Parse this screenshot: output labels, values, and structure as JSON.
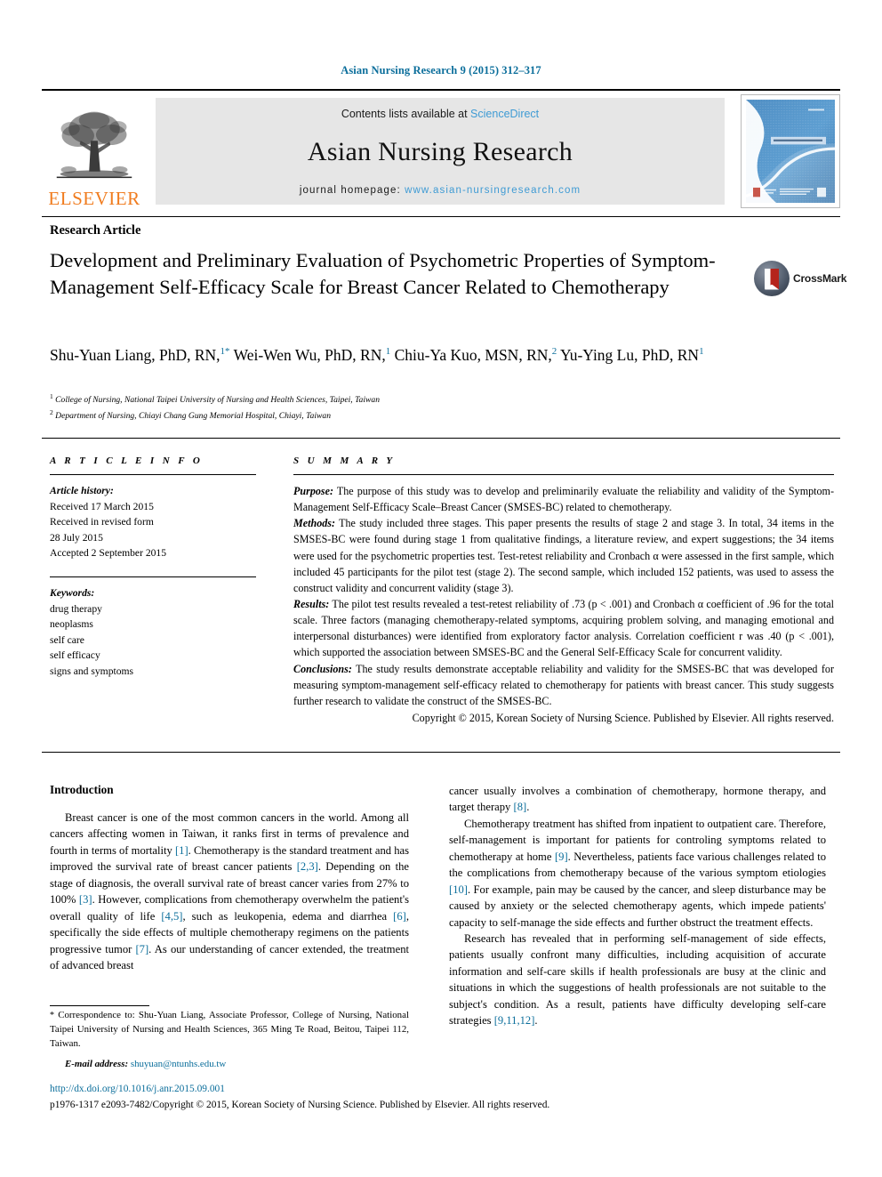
{
  "running_head": "Asian Nursing Research 9 (2015) 312–317",
  "masthead": {
    "contents_prefix": "Contents lists available at ",
    "contents_link": "ScienceDirect",
    "journal_name": "Asian Nursing Research",
    "homepage_prefix": "journal homepage: ",
    "homepage_url": "www.asian-nursingresearch.com",
    "publisher_wordmark": "ELSEVIER",
    "publisher_logo_icon": "elsevier-tree-icon",
    "cover_thumbnail_icon": "journal-cover-thumbnail",
    "cover_title_text": "ASIAN NURSING RESEARCH",
    "link_color": "#3f9bd4",
    "brand_orange": "#f07c1f"
  },
  "article": {
    "kicker": "Research Article",
    "title": "Development and Preliminary Evaluation of Psychometric Properties of Symptom-Management Self-Efficacy Scale for Breast Cancer Related to Chemotherapy",
    "crossmark_label": "CrossMark",
    "crossmark_icon": "crossmark-badge-icon",
    "authors_line1": "Shu-Yuan Liang, PhD, RN,",
    "authors": [
      {
        "name": "Shu-Yuan Liang, PhD, RN,",
        "sup": "1",
        "star": "*"
      },
      {
        "name": "Wei-Wen Wu, PhD, RN,",
        "sup": "1",
        "star": ""
      },
      {
        "name": "Chiu-Ya Kuo, MSN, RN,",
        "sup": "2",
        "star": ""
      },
      {
        "name": "Yu-Ying Lu, PhD, RN",
        "sup": "1",
        "star": ""
      }
    ],
    "affiliations": [
      {
        "marker": "1",
        "text": "College of Nursing, National Taipei University of Nursing and Health Sciences, Taipei, Taiwan"
      },
      {
        "marker": "2",
        "text": "Department of Nursing, Chiayi Chang Gung Memorial Hospital, Chiayi, Taiwan"
      }
    ]
  },
  "article_info": {
    "heading": "A R T I C L E  I N F O",
    "history_label": "Article history:",
    "history": [
      "Received 17 March 2015",
      "Received in revised form",
      "28 July 2015",
      "Accepted 2 September 2015"
    ],
    "keywords_label": "Keywords:",
    "keywords": [
      "drug therapy",
      "neoplasms",
      "self care",
      "self efficacy",
      "signs and symptoms"
    ]
  },
  "summary": {
    "heading": "S U M M A R Y",
    "sections": [
      {
        "label": "Purpose:",
        "text": " The purpose of this study was to develop and preliminarily evaluate the reliability and validity of the Symptom-Management Self-Efficacy Scale–Breast Cancer (SMSES-BC) related to chemotherapy."
      },
      {
        "label": "Methods:",
        "text": " The study included three stages. This paper presents the results of stage 2 and stage 3. In total, 34 items in the SMSES-BC were found during stage 1 from qualitative findings, a literature review, and expert suggestions; the 34 items were used for the psychometric properties test. Test-retest reliability and Cronbach α were assessed in the first sample, which included 45 participants for the pilot test (stage 2). The second sample, which included 152 patients, was used to assess the construct validity and concurrent validity (stage 3)."
      },
      {
        "label": "Results:",
        "text": " The pilot test results revealed a test-retest reliability of .73 (p < .001) and Cronbach α coefficient of .96 for the total scale. Three factors (managing chemotherapy-related symptoms, acquiring problem solving, and managing emotional and interpersonal disturbances) were identified from exploratory factor analysis. Correlation coefficient r was .40 (p < .001), which supported the association between SMSES-BC and the General Self-Efficacy Scale for concurrent validity."
      },
      {
        "label": "Conclusions:",
        "text": " The study results demonstrate acceptable reliability and validity for the SMSES-BC that was developed for measuring symptom-management self-efficacy related to chemotherapy for patients with breast cancer. This study suggests further research to validate the construct of the SMSES-BC."
      }
    ],
    "copyright": "Copyright © 2015, Korean Society of Nursing Science. Published by Elsevier. All rights reserved."
  },
  "introduction": {
    "heading": "Introduction",
    "left_paragraphs": [
      "Breast cancer is one of the most common cancers in the world. Among all cancers affecting women in Taiwan, it ranks first in terms of prevalence and fourth in terms of mortality [1]. Chemotherapy is the standard treatment and has improved the survival rate of breast cancer patients [2,3]. Depending on the stage of diagnosis, the overall survival rate of breast cancer varies from 27% to 100% [3]. However, complications from chemotherapy overwhelm the patient's overall quality of life [4,5], such as leukopenia, edema and diarrhea [6], specifically the side effects of multiple chemotherapy regimens on the patients progressive tumor [7]. As our understanding of cancer extended, the treatment of advanced breast"
    ],
    "right_paragraphs": [
      "cancer usually involves a combination of chemotherapy, hormone therapy, and target therapy [8].",
      "Chemotherapy treatment has shifted from inpatient to outpatient care. Therefore, self-management is important for patients for controling symptoms related to chemotherapy at home [9]. Nevertheless, patients face various challenges related to the complications from chemotherapy because of the various symptom etiologies [10]. For example, pain may be caused by the cancer, and sleep disturbance may be caused by anxiety or the selected chemotherapy agents, which impede patients' capacity to self-manage the side effects and further obstruct the treatment effects.",
      "Research has revealed that in performing self-management of side effects, patients usually confront many difficulties, including acquisition of accurate information and self-care skills if health professionals are busy at the clinic and situations in which the suggestions of health professionals are not suitable to the subject's condition. As a result, patients have difficulty developing self-care strategies [9,11,12]."
    ]
  },
  "footer": {
    "correspondence_star": "*",
    "correspondence": " Correspondence to: Shu-Yuan Liang, Associate Professor, College of Nursing, National Taipei University of Nursing and Health Sciences, 365 Ming Te Road, Beitou, Taipei 112, Taiwan.",
    "email_label": "E-mail address:",
    "email": "shuyuan@ntunhs.edu.tw",
    "doi": "http://dx.doi.org/10.1016/j.anr.2015.09.001",
    "issn_line": "p1976-1317 e2093-7482/Copyright © 2015, Korean Society of Nursing Science. Published by Elsevier. All rights reserved.",
    "link_color": "#0b6e9b"
  }
}
